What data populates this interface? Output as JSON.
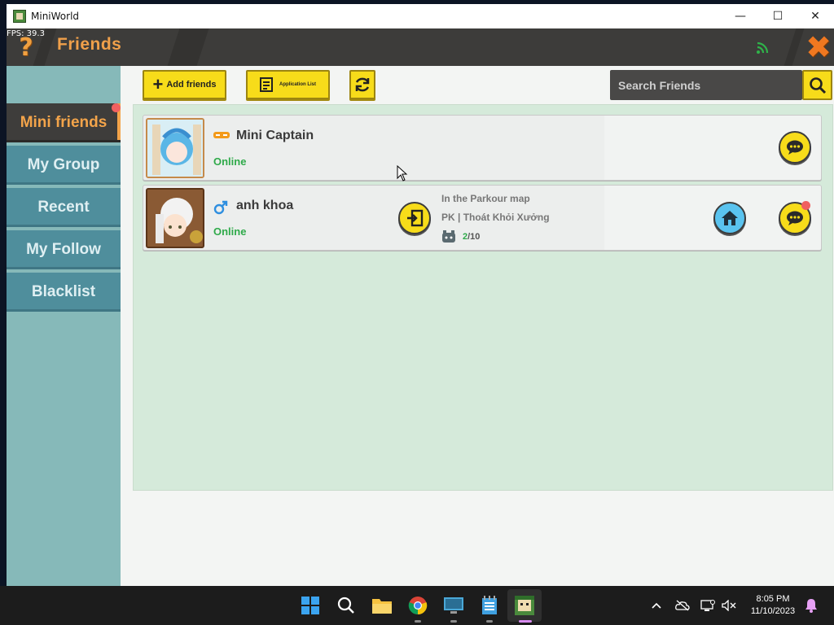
{
  "window": {
    "title": "MiniWorld",
    "minimize": "—",
    "maximize": "☐",
    "close": "✕"
  },
  "game": {
    "fps": "FPS: 39.3",
    "header_title": "Friends",
    "help": "?",
    "close": "✖"
  },
  "sidebar": {
    "items": [
      {
        "label": "Mini friends",
        "active": true
      },
      {
        "label": "My Group"
      },
      {
        "label": "Recent"
      },
      {
        "label": "My Follow"
      },
      {
        "label": "Blacklist"
      }
    ]
  },
  "toolbar": {
    "add_friends": "Add friends",
    "application_list": "Application List",
    "search_placeholder": "Search Friends"
  },
  "friends": [
    {
      "name": "Mini Captain",
      "status": "Online",
      "badge_icon": "mask-icon"
    },
    {
      "name": "anh khoa",
      "status": "Online",
      "gender_icon": "male-icon",
      "map_title": "In the Parkour map",
      "map_name": "PK | Thoát Khỏi Xưởng",
      "players_current": "2",
      "players_max": "/10"
    }
  ],
  "taskbar": {
    "time": "8:05 PM",
    "date": "11/10/2023"
  },
  "colors": {
    "accent_orange": "#f0a04a",
    "button_yellow": "#f7dc1a",
    "online_green": "#2faa4a",
    "sidebar_teal": "#4f8e9c"
  }
}
